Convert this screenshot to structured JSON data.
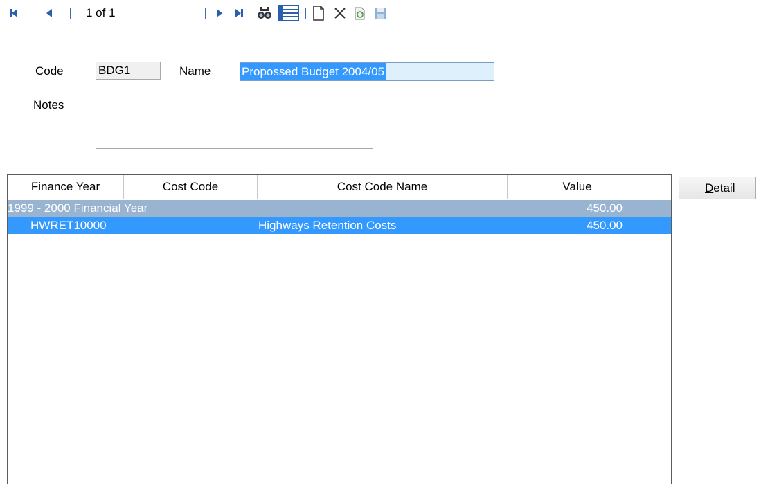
{
  "toolbar": {
    "record_position": "1 of 1",
    "icons": [
      "first-record-icon",
      "previous-record-icon",
      "next-record-icon",
      "last-record-icon",
      "find-icon",
      "list-view-icon",
      "new-record-icon",
      "delete-icon",
      "refresh-icon",
      "save-icon"
    ]
  },
  "form": {
    "code_label": "Code",
    "code_value": "BDG1",
    "name_label": "Name",
    "name_value": "Propossed Budget 2004/05",
    "notes_label": "Notes",
    "notes_value": ""
  },
  "grid": {
    "columns": [
      "Finance Year",
      "Cost Code",
      "Cost Code Name",
      "Value"
    ],
    "group_row": {
      "label": "1999 - 2000 Financial Year",
      "value": "450.00"
    },
    "rows": [
      {
        "cost_code": "HWRET10000",
        "cost_code_name": "Highways Retention Costs",
        "value": "450.00"
      }
    ]
  },
  "buttons": {
    "detail_first": "D",
    "detail_rest": "etail"
  },
  "colors": {
    "selection": "#3399ff",
    "group_row": "#99b4d1",
    "toolbar_icon": "#2a5fad",
    "name_field_bg": "#ddf0fb"
  }
}
